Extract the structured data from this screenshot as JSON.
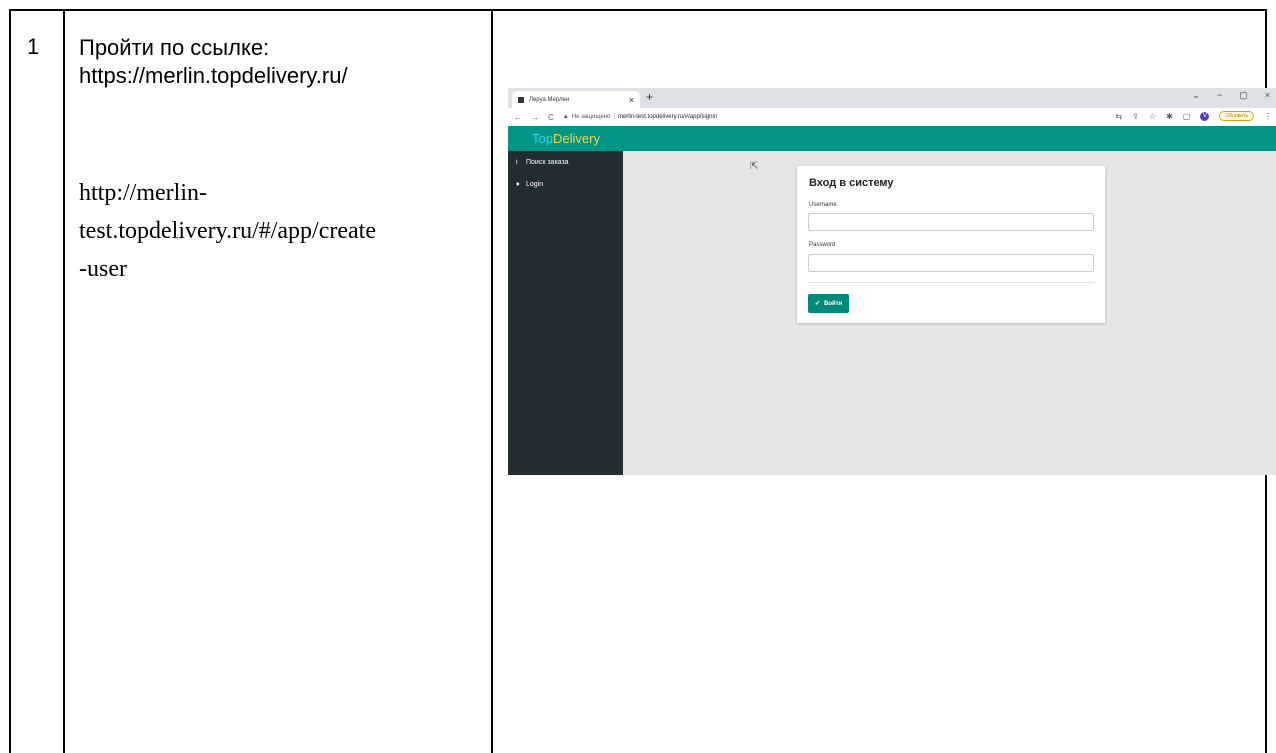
{
  "row": {
    "number": "1",
    "instruction_line1": "Пройти по ссылке:",
    "instruction_line2": "https://merlin.topdelivery.ru/",
    "alt_url_line1": "http://merlin-",
    "alt_url_line2": "test.topdelivery.ru/#/app/create",
    "alt_url_line3": "-user"
  },
  "browser": {
    "tab_title": "Леруа Мерлен",
    "tab_close": "×",
    "new_tab": "+",
    "window_controls": [
      "⌄",
      "−",
      "▢",
      "×"
    ],
    "nav_icons": [
      "←",
      "→",
      "C"
    ],
    "security_warning": "Не защищено",
    "separator": "|",
    "url": "merlin-test.topdelivery.ru/#/app/signin",
    "toolbar_icons": [
      "⇆",
      "⇪",
      "☆",
      "✱",
      "▢"
    ],
    "profile_initial": "V",
    "update_label": "Обновить",
    "menu_icon": "⋮"
  },
  "app": {
    "brand_part1": "Top",
    "brand_part2": "Delivery",
    "sidebar": [
      {
        "icon": "i",
        "label": "Поиск заказа"
      },
      {
        "icon": "♦",
        "label": "Login"
      }
    ],
    "login": {
      "title": "Вход в систему",
      "username_label": "Username",
      "username_value": "",
      "password_label": "Password",
      "password_value": "",
      "submit_icon": "✔",
      "submit_label": "Войти"
    }
  },
  "colors": {
    "header_teal": "#079583",
    "button_teal": "#00897b",
    "sidebar_dark": "#222d32"
  }
}
